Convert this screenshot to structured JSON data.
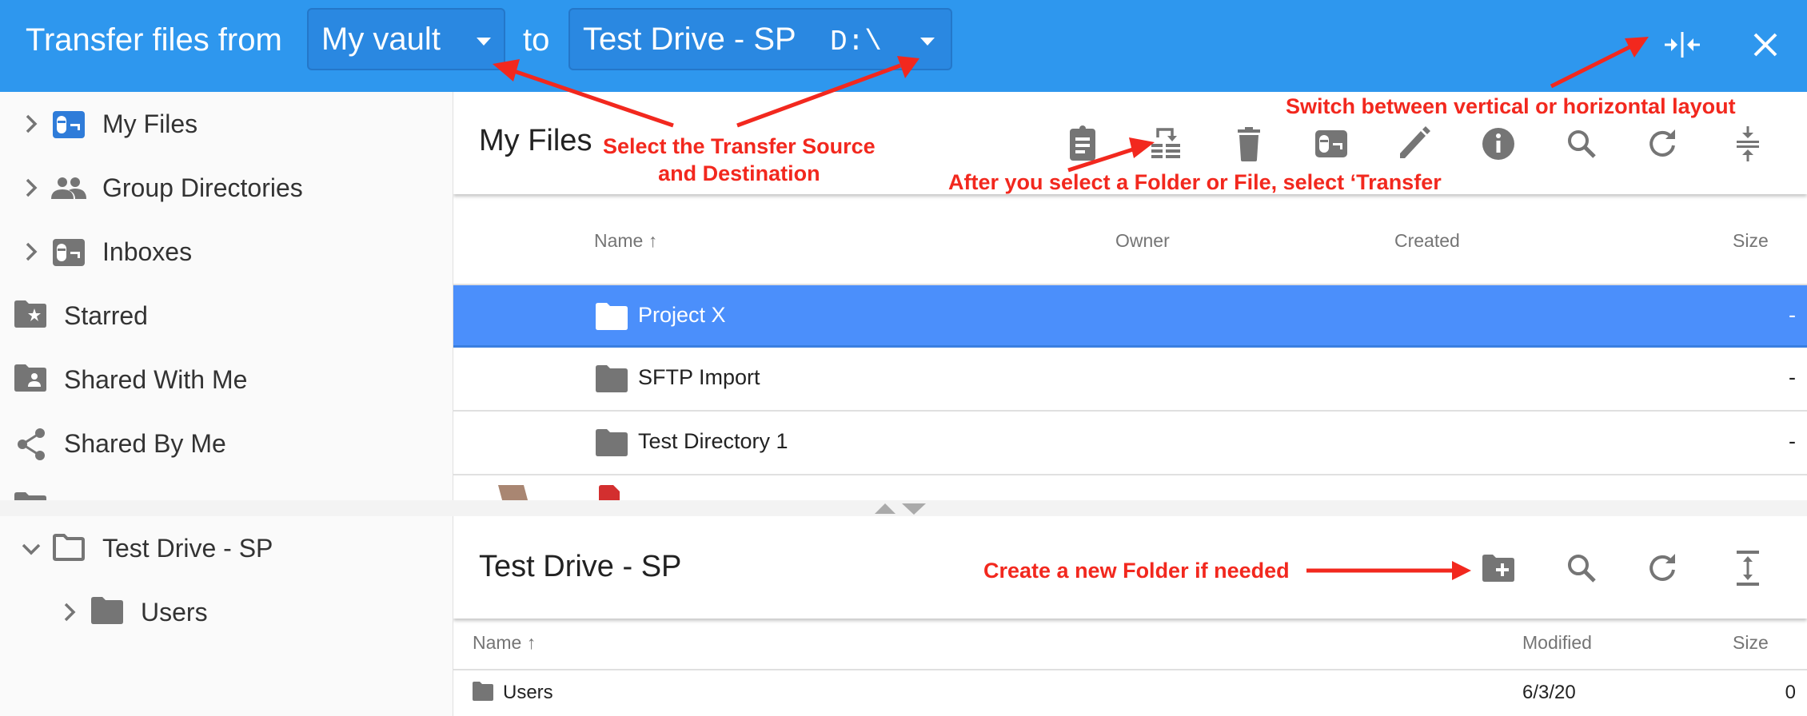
{
  "header": {
    "title": "Transfer files from",
    "source": "My vault",
    "connector": "to",
    "destination": "Test Drive - SP",
    "destination_path": "D:\\",
    "layout_toggle_icon": "vertical-split-icon",
    "close_icon": "close-icon"
  },
  "source_tree": {
    "items": [
      {
        "label": "My Files",
        "icon": "vault-icon",
        "expandable": true
      },
      {
        "label": "Group Directories",
        "icon": "group-icon",
        "expandable": true
      },
      {
        "label": "Inboxes",
        "icon": "inbox-icon",
        "expandable": true
      },
      {
        "label": "Starred",
        "icon": "starred-folder-icon",
        "expandable": false
      },
      {
        "label": "Shared With Me",
        "icon": "shared-folder-icon",
        "expandable": false
      },
      {
        "label": "Shared By Me",
        "icon": "share-icon",
        "expandable": false
      }
    ]
  },
  "source_panel": {
    "title": "My Files",
    "toolbar": [
      "clipboard-icon",
      "transfer-icon",
      "delete-icon",
      "inbox-icon",
      "edit-icon",
      "info-icon",
      "search-icon",
      "refresh-icon",
      "collapse-vertical-icon"
    ],
    "columns": {
      "name": "Name",
      "owner": "Owner",
      "created": "Created",
      "size": "Size"
    },
    "rows": [
      {
        "name": "Project X",
        "size": "-",
        "selected": true
      },
      {
        "name": "SFTP Import",
        "size": "-",
        "selected": false
      },
      {
        "name": "Test Directory 1",
        "size": "-",
        "selected": false
      }
    ]
  },
  "dest_tree": {
    "root": "Test Drive - SP",
    "children": [
      {
        "label": "Users"
      }
    ]
  },
  "dest_panel": {
    "title": "Test Drive - SP",
    "toolbar": [
      "new-folder-icon",
      "search-icon",
      "refresh-icon",
      "expand-vertical-icon"
    ],
    "columns": {
      "name": "Name",
      "modified": "Modified",
      "size": "Size"
    },
    "rows": [
      {
        "name": "Users",
        "modified": "6/3/20",
        "size": "0"
      }
    ]
  },
  "annotations": {
    "source_dest": "Select the Transfer Source\nand Destination",
    "source_dest_line1": "Select the Transfer Source",
    "source_dest_line2": "and Destination",
    "transfer": "After you select a Folder or File, select ‘Transfer",
    "layout": "Switch between vertical or horizontal layout",
    "new_folder": "Create a new Folder if needed"
  },
  "colors": {
    "header": "#2e97ee",
    "selected_row": "#4b8ffb",
    "annotation": "#f2281e",
    "icon": "#757575"
  }
}
